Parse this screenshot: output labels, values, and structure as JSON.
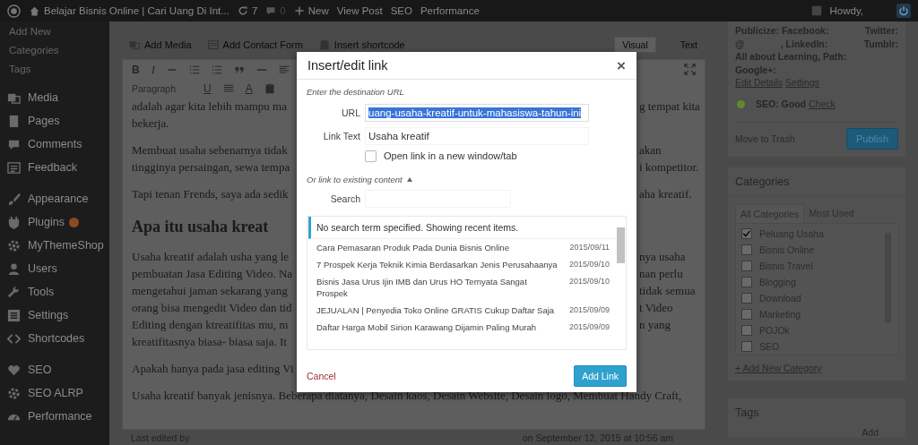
{
  "admin_bar": {
    "site_title": "Belajar Bisnis Online | Cari Uang Di Int...",
    "updates": "7",
    "comments": "0",
    "new": "New",
    "items": [
      "View Post",
      "SEO",
      "Performance"
    ],
    "greeting": "Howdy,"
  },
  "sidebar": {
    "submenu": [
      "Add New",
      "Categories",
      "Tags"
    ],
    "groups": [
      {
        "items": [
          {
            "label": "Media",
            "badge": false
          },
          {
            "label": "Pages",
            "badge": false
          },
          {
            "label": "Comments",
            "badge": false
          },
          {
            "label": "Feedback",
            "badge": false
          }
        ]
      },
      {
        "items": [
          {
            "label": "Appearance",
            "badge": false
          },
          {
            "label": "Plugins",
            "badge": true
          },
          {
            "label": "MyThemeShop",
            "badge": false
          },
          {
            "label": "Users",
            "badge": false
          },
          {
            "label": "Tools",
            "badge": false
          },
          {
            "label": "Settings",
            "badge": false
          },
          {
            "label": "Shortcodes",
            "badge": false
          }
        ]
      },
      {
        "items": [
          {
            "label": "SEO",
            "badge": false
          },
          {
            "label": "SEO ALRP",
            "badge": false
          },
          {
            "label": "Performance",
            "badge": false
          }
        ]
      }
    ]
  },
  "editor": {
    "media_buttons": [
      "Add Media",
      "Add Contact Form",
      "Insert shortcode"
    ],
    "tabs": [
      {
        "label": "Visual",
        "selected": true
      },
      {
        "label": "Text",
        "selected": false
      }
    ],
    "toolbar_row_1": [
      "B",
      "I"
    ],
    "toolbar_row_2": {
      "dropdown": "Paragraph",
      "labels": [
        "U",
        "A"
      ]
    },
    "blocks": [
      {
        "kind": "paragraph",
        "lines": [
          {
            "left": "adalah agar kita lebih mampu ma",
            "right": "g tempat kita"
          },
          {
            "left": "bekerja."
          }
        ]
      },
      {
        "kind": "paragraph",
        "lines": [
          {
            "left": "Membuat usaha sebenarnya tidak",
            "right": "akan"
          },
          {
            "left": "tingginya persaingan, sewa tempa",
            "right": "i kompetitor."
          }
        ]
      },
      {
        "kind": "paragraph",
        "lines": [
          {
            "left": "Tapi tenan Frends, saya ada sedik",
            "right": "aha kreatif."
          }
        ]
      },
      {
        "kind": "heading",
        "lines": [
          {
            "left": "Apa itu usaha kreat"
          }
        ]
      },
      {
        "kind": "paragraph",
        "lines": [
          {
            "left": "Usaha kreatif adalah usha yang le",
            "right": "nya usaha"
          },
          {
            "left": "pembuatan Jasa Editing Video. Na",
            "right": "nan perlu"
          },
          {
            "left": "mengetahui jaman sekarang yang",
            "right": "tidak semua"
          },
          {
            "left": "orang bisa mengedit Video dan tid",
            "right": "t Video"
          },
          {
            "left": "Editing dengan ktreatifitas mu, m",
            "right": "n yang"
          },
          {
            "left": "kreatifitasnya biasa- biasa saja. It"
          }
        ]
      },
      {
        "kind": "paragraph",
        "lines": [
          {
            "left": "Apakah hanya pada jasa editing Vi"
          }
        ]
      },
      {
        "kind": "paragraph",
        "lines": [
          {
            "left": "Usaha kreatif banyak jenisnya. Beberapa diatanya, Desain kaos, Desain Website, Desain logo, Membuat Handy Craft,"
          }
        ]
      }
    ],
    "footer": {
      "last_edited": "Last edited by",
      "date": "on September 12, 2015 at 10:56 am"
    }
  },
  "publish_box": {
    "publicize": [
      [
        "Publicize: Facebook:",
        "Twitter:"
      ],
      [
        "@",
        ", LinkedIn:",
        "Tumblr:"
      ],
      [
        "All about Learning, Path:"
      ],
      [
        "Google+:"
      ]
    ],
    "links": [
      "Edit Details",
      "Settings"
    ],
    "seo": {
      "status": "SEO: Good",
      "link": "Check",
      "color": "#5e8a2c"
    },
    "trash": "Move to Trash",
    "publish": "Publish"
  },
  "categories": {
    "title": "Categories",
    "tabs": [
      {
        "label": "All Categories",
        "selected": true
      },
      {
        "label": "Most Used",
        "selected": false
      }
    ],
    "items": [
      {
        "label": "Peluang Usaha",
        "checked": true
      },
      {
        "label": "Bisnis Online",
        "checked": false
      },
      {
        "label": "Bisnis Travel",
        "checked": false
      },
      {
        "label": "Blogging",
        "checked": false
      },
      {
        "label": "Download",
        "checked": false
      },
      {
        "label": "Marketing",
        "checked": false
      },
      {
        "label": "POJOk",
        "checked": false
      },
      {
        "label": "SEO",
        "checked": false
      }
    ],
    "add_new": "+ Add New Category"
  },
  "tags": {
    "title": "Tags",
    "button": "Add"
  },
  "dialog": {
    "title": "Insert/edit link",
    "close": "×",
    "intro": "Enter the destination URL",
    "fields": [
      {
        "label": "URL",
        "value": "uang-usaha-kreatif-untuk-mahasiswa-tahun-ini",
        "text_selected": true
      },
      {
        "label": "Link Text",
        "value": "Usaha kreatif",
        "text_selected": false
      }
    ],
    "new_tab": {
      "label": "Open link in a new window/tab",
      "checked": false
    },
    "existing": {
      "label": "Or link to existing content",
      "expanded": true
    },
    "search": {
      "label": "Search"
    },
    "notice": "No search term specified. Showing recent items.",
    "results": [
      {
        "title": "Cara Pemasaran Produk Pada Dunia Bisnis Online",
        "date": "2015/09/11"
      },
      {
        "title": "7 Prospek Kerja Teknik Kimia Berdasarkan Jenis Perusahaanya",
        "date": "2015/09/10"
      },
      {
        "title": "Bisnis Jasa Urus Ijin IMB dan Urus HO Ternyata Sangat Prospek",
        "date": "2015/09/10"
      },
      {
        "title": "JEJUALAN | Penyedia Toko Online GRATIS Cukup Daftar Saja",
        "date": "2015/09/09"
      },
      {
        "title": "Daftar Harga Mobil Sirion Karawang Dijamin Paling Murah",
        "date": "2015/09/09"
      }
    ],
    "cancel": "Cancel",
    "submit": "Add Link"
  }
}
